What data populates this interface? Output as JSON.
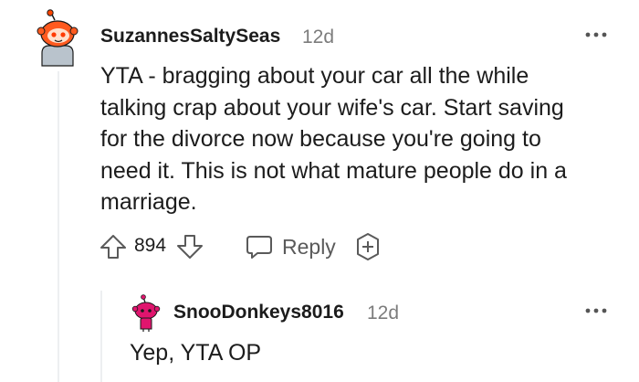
{
  "comments": [
    {
      "username": "SuzannesSaltySeas",
      "age": "12d",
      "body_lines": [
        "YTA - bragging about your car all the while",
        "talking crap about your wife's car. Start saving",
        "for the divorce now because you're going to",
        "need it. This is not what mature people do in a",
        "marriage."
      ],
      "votes": "894",
      "reply_label": "Reply",
      "avatar_icon": "snoo-avatar-orange-icon"
    },
    {
      "username": "SnooDonkeys8016",
      "age": "12d",
      "body": "Yep, YTA OP",
      "avatar_icon": "snoo-avatar-pink-icon"
    }
  ],
  "icons": {
    "more": "more-options-icon",
    "upvote": "upvote-arrow-icon",
    "downvote": "downvote-arrow-icon",
    "reply": "speech-bubble-icon",
    "award": "award-plus-icon"
  },
  "colors": {
    "text": "#1c1c1c",
    "meta": "#7c7c7c",
    "icon": "#878a8c",
    "avatar1": "#ff4500",
    "avatar2": "#e0156e",
    "thread_line": "#edeff1"
  }
}
